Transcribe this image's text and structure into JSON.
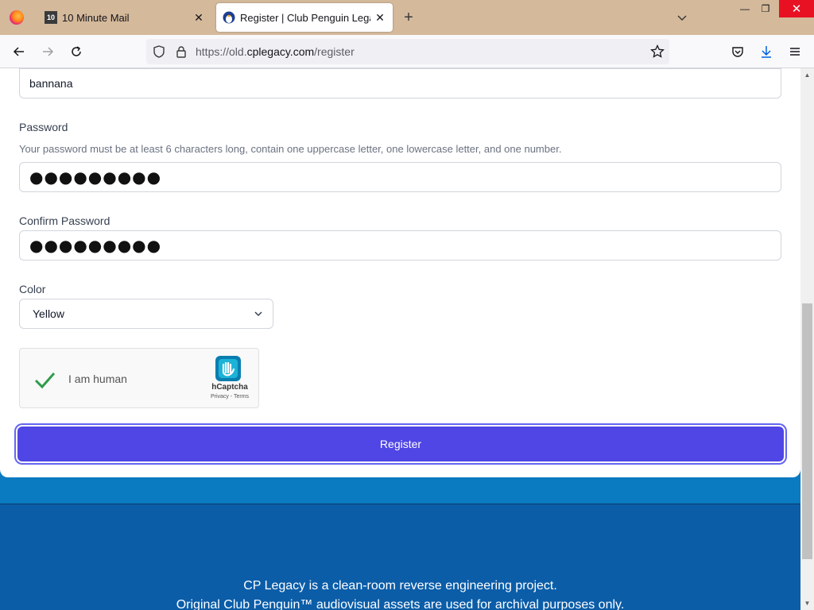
{
  "browser": {
    "tabs": [
      {
        "title": "10 Minute Mail",
        "icon": "10-minute-mail-icon",
        "icon_text": "10"
      },
      {
        "title": "Register | Club Penguin Legacy",
        "icon": "penguin-icon"
      }
    ],
    "url_prefix": "https://old.",
    "url_domain": "cplegacy.com",
    "url_path": "/register"
  },
  "form": {
    "username_value": "bannana",
    "password_label": "Password",
    "password_hint": "Your password must be at least 6 characters long, contain one uppercase letter, one lowercase letter, and one number.",
    "password_mask": "●●●●●●●●●",
    "confirm_label": "Confirm Password",
    "confirm_mask": "●●●●●●●●●",
    "color_label": "Color",
    "color_value": "Yellow",
    "captcha_label": "I am human",
    "captcha_brand": "hCaptcha",
    "captcha_links": "Privacy - Terms",
    "register_label": "Register"
  },
  "footer": {
    "line1": "CP Legacy is a clean-room reverse engineering project.",
    "line2": "Original Club Penguin™ audiovisual assets are used for archival purposes only."
  },
  "colors": {
    "accent": "#4f46e5",
    "footer_bg": "#0b5da8",
    "band_bg": "#0a7bc0",
    "check": "#2e9d4a"
  }
}
